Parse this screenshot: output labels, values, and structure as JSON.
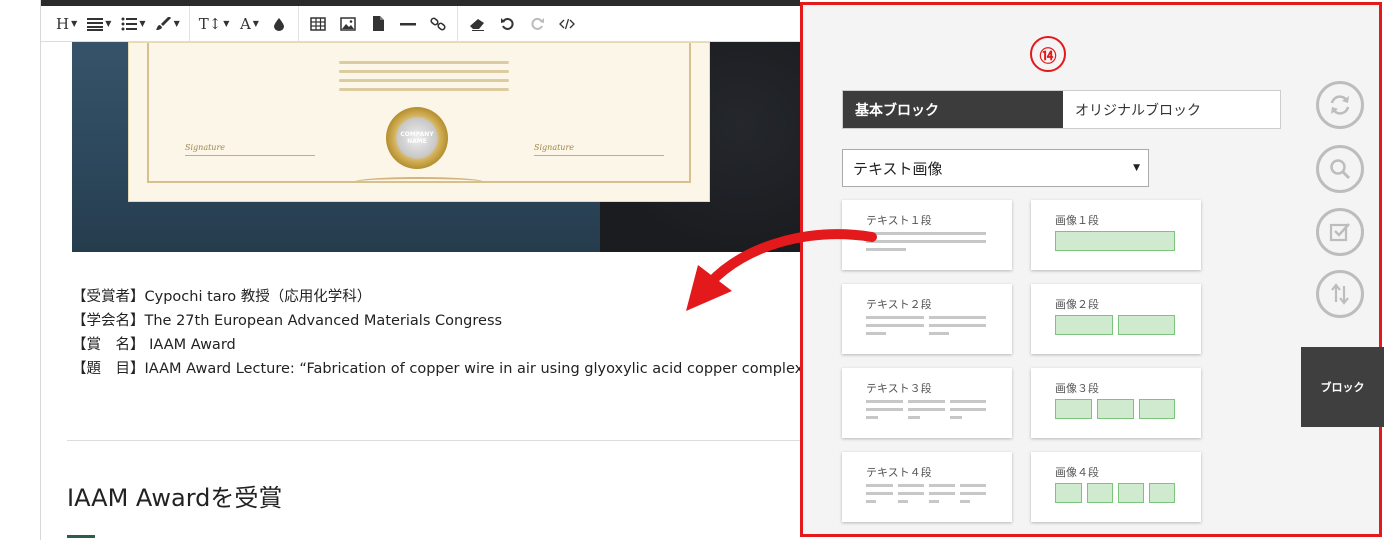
{
  "toolbar": {
    "heading_label": "H",
    "text_size_label": "T↕",
    "font_color_label": "A"
  },
  "certificate": {
    "seal_text": "COMPANY NAME",
    "signature_left": "Signature",
    "signature_right": "Signature"
  },
  "award_info": [
    "【受賞者】Cypochi taro 教授（応用化学科）",
    "【学会名】The 27th European Advanced Materials Congress",
    "【賞　名】 IAAM Award",
    "【題　目】IAAM Award Lecture: “Fabrication of copper wire in air using glyoxylic acid copper complex”"
  ],
  "section_title": "IAAM Awardを受賞",
  "panel": {
    "badge": "⑭",
    "tabs": [
      "基本ブロック",
      "オリジナルブロック"
    ],
    "active_tab": 0,
    "select_value": "テキスト画像",
    "text_cards": [
      "テキスト１段",
      "テキスト２段",
      "テキスト３段",
      "テキスト４段"
    ],
    "image_cards": [
      "画像１段",
      "画像２段",
      "画像３段",
      "画像４段"
    ],
    "side_icons": [
      "refresh-icon",
      "zoom-icon",
      "check-icon",
      "sort-icon"
    ],
    "block_tab_label": "ブロック"
  },
  "colors": {
    "highlight_red": "#e3191c",
    "tab_dark": "#3c3c3c",
    "image_fill": "#cfeacf",
    "image_border": "#7cc47c"
  }
}
